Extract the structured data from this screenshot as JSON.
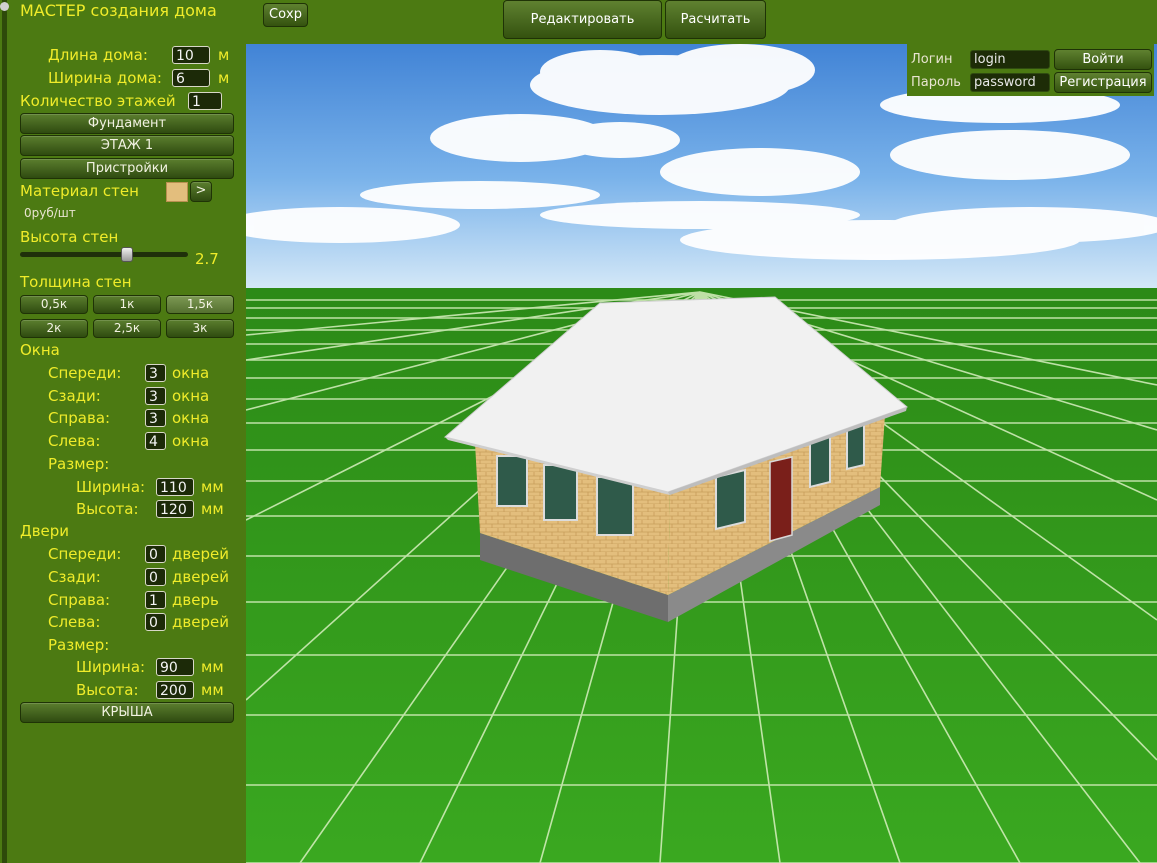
{
  "toolbar": {
    "save": "Сохр",
    "edit": "Редактировать",
    "calc": "Расчитать"
  },
  "login": {
    "login_label": "Логин",
    "login_value": "login",
    "password_label": "Пароль",
    "password_value": "password",
    "enter": "Войти",
    "register": "Регистрация"
  },
  "wizard": {
    "title": "МАСТЕР создания дома",
    "length_label": "Длина дома:",
    "length_value": "10",
    "length_unit": "м",
    "width_label": "Ширина дома:",
    "width_value": "6",
    "width_unit": "м",
    "floors_label": "Количество этажей",
    "floors_value": "1",
    "foundation": "Фундамент",
    "floor1": "ЭТАЖ 1",
    "extensions": "Пристройки",
    "wall_material_label": "Материал стен",
    "next_arrow": ">",
    "price": "0руб/шт",
    "wall_height_label": "Высота стен",
    "wall_height_value": "2.7",
    "wall_height_fraction": 0.6,
    "thickness_label": "Толщина стен",
    "thickness": [
      "0,5к",
      "1к",
      "1,5к",
      "2к",
      "2,5к",
      "3к"
    ],
    "thickness_selected": "1,5к",
    "windows": {
      "title": "Окна",
      "front_label": "Спереди:",
      "front_value": "3",
      "front_unit": "окна",
      "back_label": "Сзади:",
      "back_value": "3",
      "back_unit": "окна",
      "right_label": "Справа:",
      "right_value": "3",
      "right_unit": "окна",
      "left_label": "Слева:",
      "left_value": "4",
      "left_unit": "окна",
      "size_label": "Размер:",
      "width_label": "Ширина:",
      "width_value": "110",
      "width_unit": "мм",
      "height_label": "Высота:",
      "height_value": "120",
      "height_unit": "мм"
    },
    "doors": {
      "title": "Двери",
      "front_label": "Спереди:",
      "front_value": "0",
      "front_unit": "дверей",
      "back_label": "Сзади:",
      "back_value": "0",
      "back_unit": "дверей",
      "right_label": "Справа:",
      "right_value": "1",
      "right_unit": "дверь",
      "left_label": "Слева:",
      "left_value": "0",
      "left_unit": "дверей",
      "size_label": "Размер:",
      "width_label": "Ширина:",
      "width_value": "90",
      "width_unit": "мм",
      "height_label": "Высота:",
      "height_value": "200",
      "height_unit": "мм"
    },
    "roof": "КРЫША"
  },
  "colors": {
    "panel": "#4c7a12",
    "label": "#f0ec2a",
    "grass": "#3fa61e",
    "grid": "#d8f0c0",
    "sky": "#5e9ee0"
  }
}
